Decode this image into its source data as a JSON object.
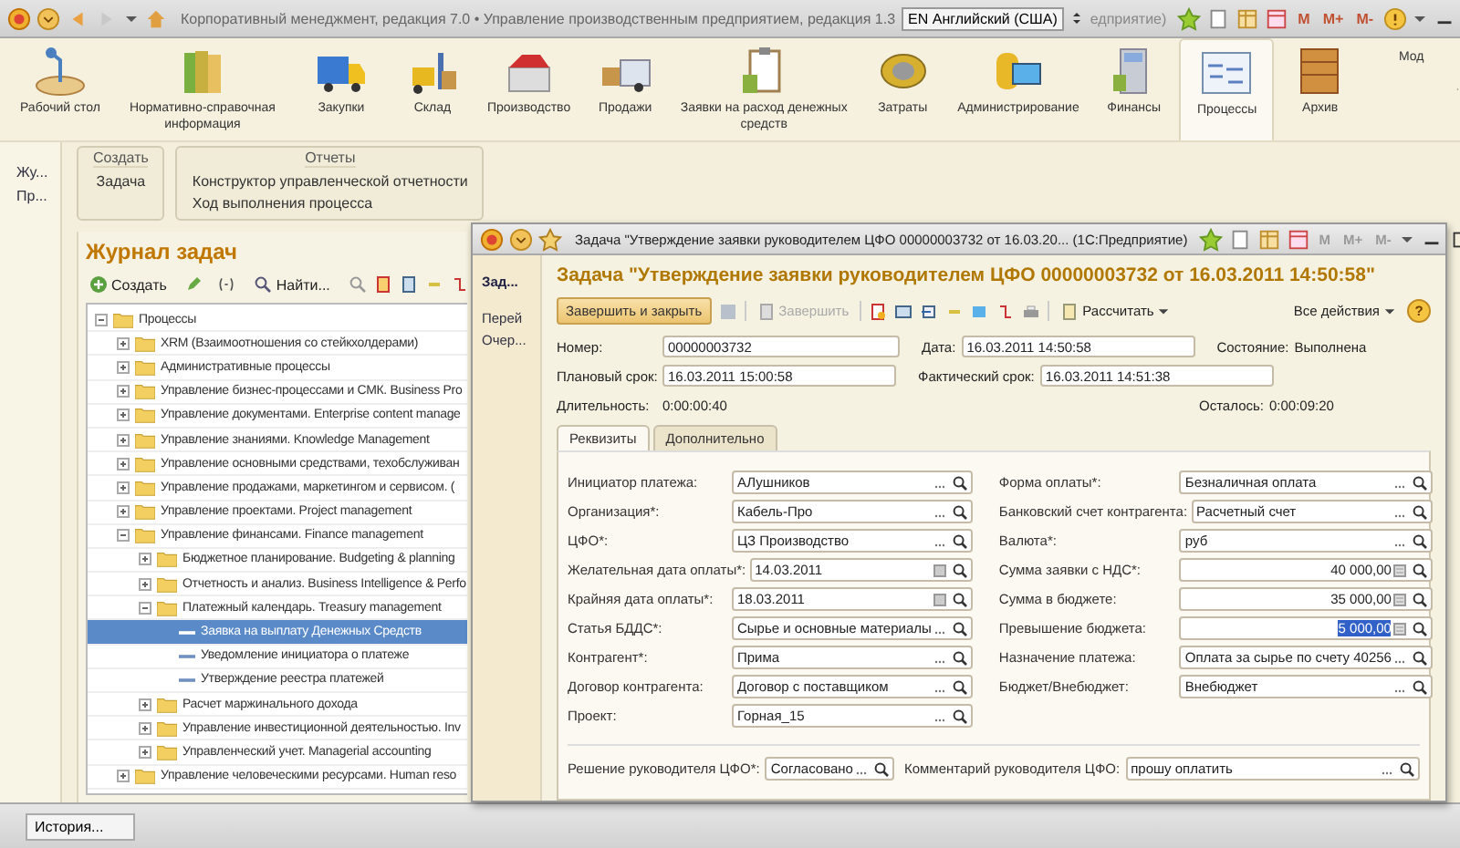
{
  "main_window": {
    "title": "Корпоративный менеджмент, редакция 7.0 • Управление производственным предприятием, редакция 1.3",
    "language": "EN Английский (США)",
    "title_tail": "едприятие)",
    "memory_buttons": [
      "M",
      "M+",
      "M-"
    ]
  },
  "sections": [
    {
      "label": "Рабочий стол",
      "selected": false
    },
    {
      "label": "Нормативно-справочная информация",
      "selected": false
    },
    {
      "label": "Закупки",
      "selected": false
    },
    {
      "label": "Склад",
      "selected": false
    },
    {
      "label": "Производство",
      "selected": false
    },
    {
      "label": "Продажи",
      "selected": false
    },
    {
      "label": "Заявки на расход денежных средств",
      "selected": false
    },
    {
      "label": "Затраты",
      "selected": false
    },
    {
      "label": "Администрирование",
      "selected": false
    },
    {
      "label": "Финансы",
      "selected": false
    },
    {
      "label": "Процессы",
      "selected": true
    },
    {
      "label": "Архив",
      "selected": false
    },
    {
      "label": "Мод",
      "selected": false
    }
  ],
  "nav": [
    "Жу...",
    "Пр..."
  ],
  "action_panel": {
    "groups": [
      {
        "title": "Создать",
        "items": [
          "Задача"
        ]
      },
      {
        "title": "Отчеты",
        "items": [
          "Конструктор управленческой отчетности",
          "Ход выполнения процесса"
        ]
      }
    ]
  },
  "journal": {
    "title": "Журнал задач",
    "create": "Создать",
    "find": "Найти...",
    "tree": [
      {
        "label": "Процессы",
        "kind": "folder",
        "expanded": true,
        "selected": false,
        "children": [
          {
            "label": "XRM (Взаимоотношения со стейкхолдерами)",
            "kind": "folder",
            "expanded": false,
            "selected": false
          },
          {
            "label": "Административные процессы",
            "kind": "folder",
            "expanded": false,
            "selected": false
          },
          {
            "label": "Управление бизнес-процессами и СМК. Business Pro",
            "kind": "folder",
            "expanded": false,
            "selected": false
          },
          {
            "label": "Управление документами. Enterprise content manage",
            "kind": "folder",
            "expanded": false,
            "selected": false
          },
          {
            "label": "Управление знаниями. Knowledge Management",
            "kind": "folder",
            "expanded": false,
            "selected": false
          },
          {
            "label": "Управление основными средствами, техобслуживан",
            "kind": "folder",
            "expanded": false,
            "selected": false
          },
          {
            "label": "Управление продажами, маркетингом и сервисом. (",
            "kind": "folder",
            "expanded": false,
            "selected": false
          },
          {
            "label": "Управление проектами. Project management",
            "kind": "folder",
            "expanded": false,
            "selected": false
          },
          {
            "label": "Управление финансами. Finance management",
            "kind": "folder",
            "expanded": true,
            "selected": false,
            "children": [
              {
                "label": "Бюджетное планирование. Budgeting & planning",
                "kind": "folder",
                "expanded": false,
                "selected": false
              },
              {
                "label": "Отчетность и анализ. Business Intelligence & Perfo",
                "kind": "folder",
                "expanded": false,
                "selected": false
              },
              {
                "label": "Платежный календарь. Treasury management",
                "kind": "folder",
                "expanded": true,
                "selected": false,
                "children": [
                  {
                    "label": "Заявка на выплату Денежных Средств",
                    "kind": "task",
                    "selected": true
                  },
                  {
                    "label": "Уведомление инициатора о платеже",
                    "kind": "task",
                    "selected": false
                  },
                  {
                    "label": "Утверждение реестра платежей",
                    "kind": "task",
                    "selected": false
                  }
                ]
              },
              {
                "label": "Расчет маржинального дохода",
                "kind": "folder",
                "expanded": false,
                "selected": false
              },
              {
                "label": "Управление инвестиционной деятельностью. Inv",
                "kind": "folder",
                "expanded": false,
                "selected": false
              },
              {
                "label": "Управленческий учет. Managerial accounting",
                "kind": "folder",
                "expanded": false,
                "selected": false
              }
            ]
          },
          {
            "label": "Управление человеческими ресурсами. Human reso",
            "kind": "folder",
            "expanded": false,
            "selected": false
          }
        ]
      }
    ]
  },
  "task_window": {
    "title": "Задача \"Утверждение заявки руководителем ЦФО  00000003732 от 16.03.20...  (1С:Предприятие)",
    "memory_buttons": [
      "M",
      "M+",
      "M-"
    ],
    "nav": [
      {
        "label": "Зад...",
        "selected": true
      },
      {
        "label": "Перей",
        "selected": false
      },
      {
        "label": "Очер...",
        "selected": false
      }
    ],
    "heading": "Задача \"Утверждение заявки руководителем ЦФО  00000003732 от 16.03.2011 14:50:58\"",
    "toolbar": [
      {
        "label": "Завершить и закрыть",
        "kind": "default",
        "disabled": false
      },
      {
        "label": "Завершить",
        "kind": "plain",
        "disabled": true
      },
      {
        "label": "Рассчитать",
        "kind": "menu",
        "disabled": false
      }
    ],
    "all_actions": "Все действия",
    "help": "?",
    "header_rows": [
      [
        {
          "label": "Номер:",
          "value": "00000003732",
          "kind": "field"
        },
        {
          "label": "Дата:",
          "value": "16.03.2011 14:50:58",
          "kind": "field"
        },
        {
          "label": "Состояние:",
          "value": "Выполнена",
          "kind": "text"
        }
      ],
      [
        {
          "label": "Плановый срок:",
          "value": "16.03.2011 15:00:58",
          "kind": "field"
        },
        {
          "label": "Фактический срок:",
          "value": "16.03.2011 14:51:38",
          "kind": "field"
        }
      ],
      [
        {
          "label": "Длительность:",
          "value": "0:00:00:40",
          "kind": "text"
        },
        {
          "label": "Осталось:",
          "value": "0:00:09:20",
          "kind": "text"
        }
      ]
    ],
    "tabs": [
      {
        "label": "Реквизиты",
        "selected": true
      },
      {
        "label": "Дополнительно",
        "selected": false
      }
    ],
    "left_fields": [
      {
        "label": "Инициатор платежа:",
        "value": "АЛушников",
        "kind": "ref"
      },
      {
        "label": "Организация*:",
        "value": "Кабель-Про",
        "kind": "ref"
      },
      {
        "label": "ЦФО*:",
        "value": "ЦЗ Производство",
        "kind": "ref"
      },
      {
        "label": "Желательная дата оплаты*:",
        "value": "14.03.2011",
        "kind": "date"
      },
      {
        "label": "Крайняя дата оплаты*:",
        "value": "18.03.2011",
        "kind": "date"
      },
      {
        "label": "Статья БДДС*:",
        "value": "Сырье и основные материалы",
        "kind": "ref"
      },
      {
        "label": "Контрагент*:",
        "value": "Прима",
        "kind": "ref"
      },
      {
        "label": "Договор контрагента:",
        "value": "Договор с поставщиком",
        "kind": "ref"
      },
      {
        "label": "Проект:",
        "value": "Горная_15",
        "kind": "ref"
      }
    ],
    "right_fields": [
      {
        "label": "Форма оплаты*:",
        "value": "Безналичная оплата",
        "kind": "ref",
        "text_selected": false
      },
      {
        "label": "Банковский счет контрагента:",
        "value": "Расчетный счет",
        "kind": "ref",
        "text_selected": false
      },
      {
        "label": "Валюта*:",
        "value": "руб",
        "kind": "ref",
        "text_selected": false
      },
      {
        "label": "Сумма заявки с НДС*:",
        "value": "40 000,00",
        "kind": "number",
        "text_selected": false
      },
      {
        "label": "Сумма в бюджете:",
        "value": "35 000,00",
        "kind": "number",
        "text_selected": false
      },
      {
        "label": "Превышение бюджета:",
        "value": "5 000,00",
        "kind": "number",
        "text_selected": true
      },
      {
        "label": "Назначение платежа:",
        "value": "Оплата за сырье по счету 40256",
        "kind": "ref",
        "text_selected": false
      },
      {
        "label": "Бюджет/Внебюджет:",
        "value": "Внебюджет",
        "kind": "ref",
        "text_selected": false
      }
    ],
    "decision": [
      {
        "label": "Решение руководителя ЦФО*:",
        "value": "Согласовано"
      },
      {
        "label": "Комментарий руководителя ЦФО:",
        "value": "прошу оплатить"
      }
    ]
  },
  "status_bar": {
    "buttons": [
      "История..."
    ]
  }
}
